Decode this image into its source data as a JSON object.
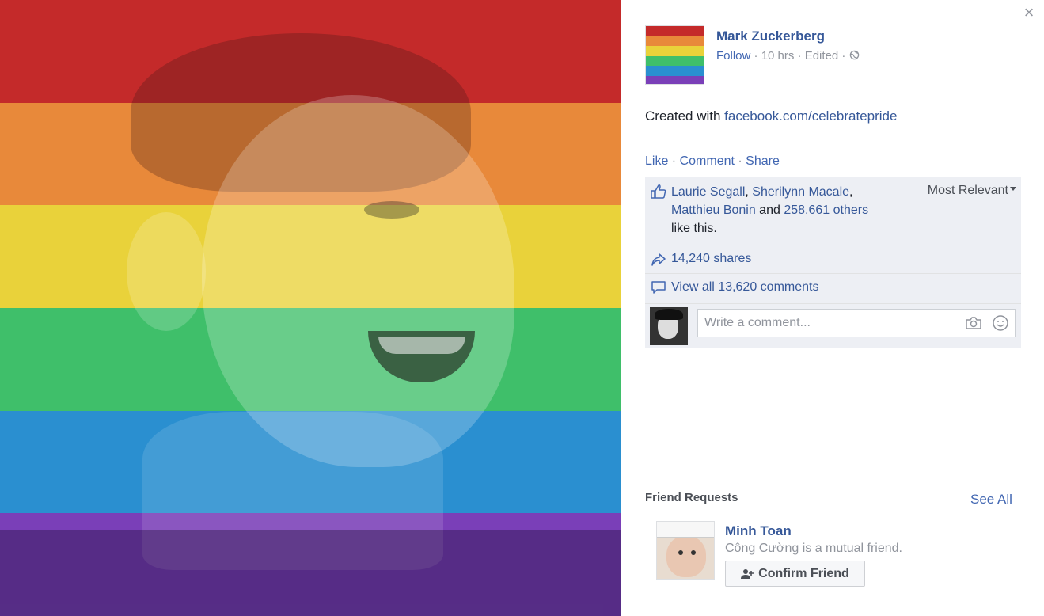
{
  "photo": {
    "stripe_colors": [
      "#c42a2a",
      "#e8893a",
      "#e9d23a",
      "#3fbf6a",
      "#2a8fd0",
      "#7a3fb8"
    ]
  },
  "post": {
    "author": "Mark Zuckerberg",
    "follow_label": "Follow",
    "meta": " · 10 hrs · Edited · ",
    "globe_icon": "globe-icon",
    "text_prefix": "Created with ",
    "text_link": "facebook.com/celebratepride"
  },
  "actions": {
    "like": "Like",
    "comment": "Comment",
    "share": "Share",
    "separator": " · "
  },
  "ufi": {
    "likers": [
      "Laurie Segall",
      "Sherilynn Macale",
      "Matthieu Bonin"
    ],
    "and": " and ",
    "others": "258,661 others",
    "like_this": "like this.",
    "sort_label": "Most Relevant",
    "shares": "14,240 shares",
    "view_comments": "View all 13,620 comments",
    "comment_placeholder": "Write a comment..."
  },
  "friend_requests": {
    "header": "Friend Requests",
    "see_all": "See All",
    "name": "Minh Toan",
    "mutual": "Công Cường is a mutual friend.",
    "confirm": "Confirm Friend"
  },
  "colors": {
    "link": "#365899",
    "accent": "#4267b2",
    "ufi_bg": "#edeff4",
    "muted": "#90949c"
  }
}
